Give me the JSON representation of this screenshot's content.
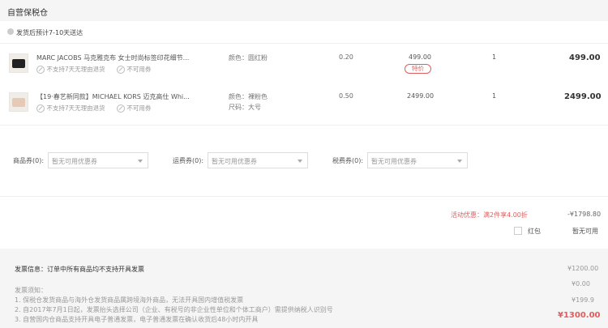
{
  "warehouse": {
    "title": "自营保税仓"
  },
  "shipping": {
    "text": "发货后预计7-10天送达"
  },
  "items": [
    {
      "title": "MARC JACOBS 马克雅克布 女士时尚标签印花细节...",
      "tag1": "不支持7天无理由退货",
      "tag2": "不可用券",
      "spec1": "颜色：圆红粉",
      "spec2": "",
      "rate": "0.20",
      "price": "499.00",
      "badge": "特价",
      "qty": "1",
      "total": "499.00"
    },
    {
      "title": "【19·春艺新同款】MICHAEL KORS 迈克高仕 Whi...",
      "tag1": "不支持7天无理由退货",
      "tag2": "不可用券",
      "spec1": "颜色：裸粉色",
      "spec2": "尺码：大号",
      "rate": "0.50",
      "price": "2499.00",
      "badge": "",
      "qty": "1",
      "total": "2499.00"
    }
  ],
  "coupons": [
    {
      "label": "商品券(0):",
      "placeholder": "暂无可用优惠券"
    },
    {
      "label": "运费券(0):",
      "placeholder": "暂无可用优惠券"
    },
    {
      "label": "税费券(0):",
      "placeholder": "暂无可用优惠券"
    }
  ],
  "promo": {
    "text": "活动优惠：满2件享4.00折",
    "amount": "-¥1798.80"
  },
  "redpacket": {
    "label": "红包",
    "value": "暂无可用"
  },
  "invoice": {
    "text": "发票信息：订单中所有商品均不支持开具发票"
  },
  "notice": {
    "title": "发票须知：",
    "lines": [
      "1. 保税仓发货商品与海外仓发货商品属跨境海外商品，无法开具国内增值税发票",
      "2. 自2017年7月1日起，发票抬头选择公司（企业、有税号的非企业性单位和个体工商户）需提供纳税人识别号",
      "3. 自营国内仓商品支持开具电子普通发票，电子普通发票在确认收货后48小时内开具"
    ]
  },
  "summary": {
    "line1": "¥1200.00",
    "line2": "¥0.00",
    "line3": "¥199.9",
    "pay": "¥1300.00"
  }
}
